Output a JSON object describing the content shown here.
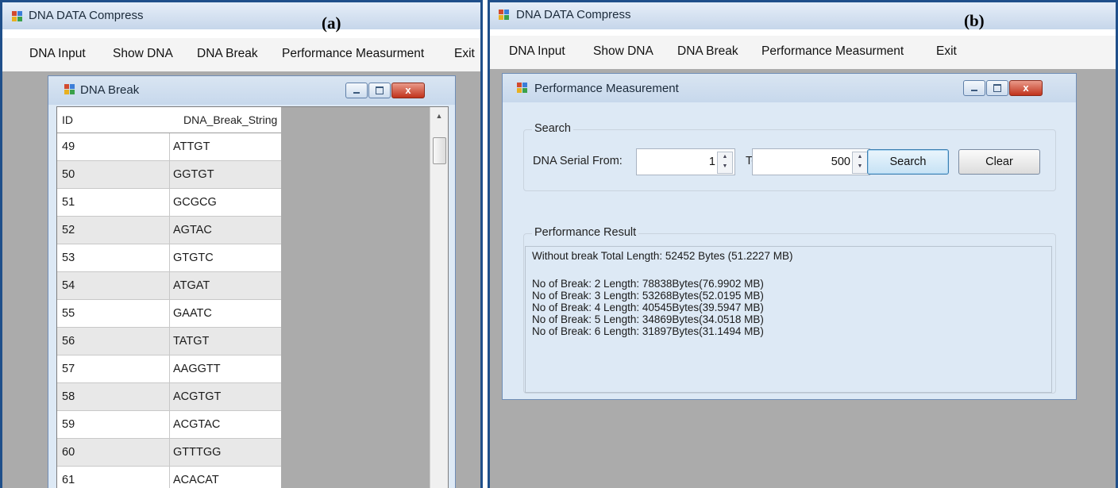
{
  "panel_a": {
    "label": "(a)",
    "app_title": "DNA DATA Compress",
    "menu": [
      "DNA Input",
      "Show DNA",
      "DNA Break",
      "Performance Measurment",
      "Exit"
    ],
    "child_window": {
      "title": "DNA Break",
      "close_glyph": "x",
      "columns": [
        "ID",
        "DNA_Break_String"
      ],
      "rows": [
        {
          "id": "49",
          "value": "ATTGT"
        },
        {
          "id": "50",
          "value": "GGTGT"
        },
        {
          "id": "51",
          "value": "GCGCG"
        },
        {
          "id": "52",
          "value": "AGTAC"
        },
        {
          "id": "53",
          "value": "GTGTC"
        },
        {
          "id": "54",
          "value": "ATGAT"
        },
        {
          "id": "55",
          "value": "GAATC"
        },
        {
          "id": "56",
          "value": "TATGT"
        },
        {
          "id": "57",
          "value": "AAGGTT"
        },
        {
          "id": "58",
          "value": "ACGTGT"
        },
        {
          "id": "59",
          "value": "ACGTAC"
        },
        {
          "id": "60",
          "value": "GTTTGG"
        },
        {
          "id": "61",
          "value": "ACACAT"
        }
      ],
      "scroll_up_glyph": "▲"
    }
  },
  "panel_b": {
    "label": "(b)",
    "app_title": "DNA DATA Compress",
    "menu": [
      "DNA Input",
      "Show DNA",
      "DNA Break",
      "Performance Measurment",
      "Exit"
    ],
    "child_window": {
      "title": "Performance Measurement",
      "close_glyph": "x",
      "search_group": {
        "label": "Search",
        "from_label": "DNA Serial From:",
        "from_value": "1",
        "to_label": "To:",
        "to_value": "500",
        "spin_glyph": "▲\n▼",
        "search_button": "Search",
        "clear_button": "Clear"
      },
      "result_group": {
        "label": "Performance Result",
        "lines": [
          "Without break Total Length: 52452 Bytes (51.2227 MB)",
          "No of Break: 2 Length: 78838Bytes(76.9902 MB)",
          "No of Break: 3 Length: 53268Bytes(52.0195 MB)",
          "No of Break: 4 Length: 40545Bytes(39.5947 MB)",
          "No of Break: 5 Length: 34869Bytes(34.0518 MB)",
          "No of Break: 6 Length: 31897Bytes(31.1494 MB)"
        ]
      }
    }
  }
}
